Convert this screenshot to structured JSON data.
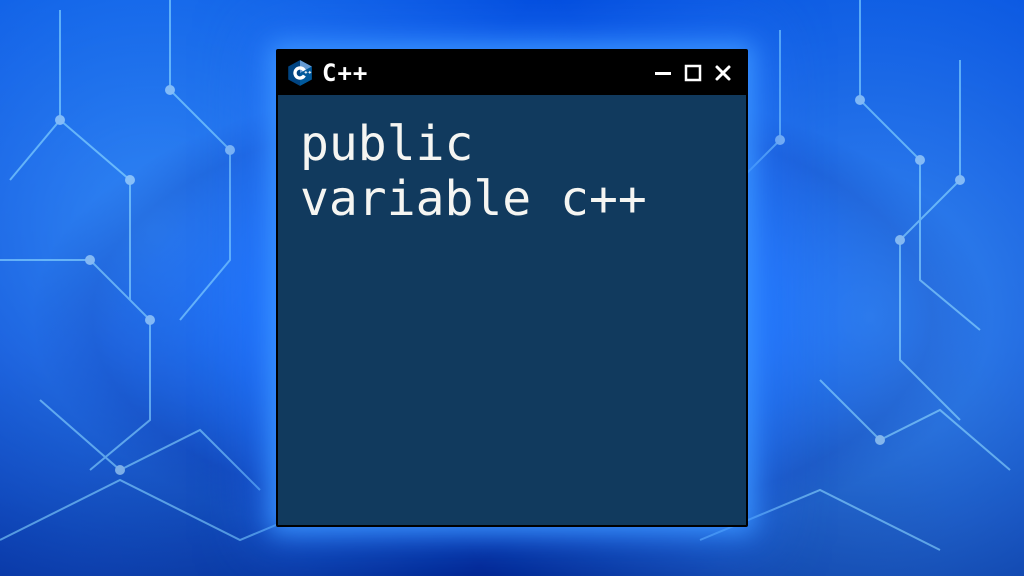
{
  "window": {
    "title": "C++",
    "controls": {
      "minimize": "–",
      "maximize": "□",
      "close": "×"
    }
  },
  "content": {
    "text": "public variable c++"
  },
  "icon": {
    "name": "cpp-logo"
  },
  "colors": {
    "window_bg": "#113a5e",
    "titlebar_bg": "#000000",
    "text": "#f5f5f2"
  }
}
